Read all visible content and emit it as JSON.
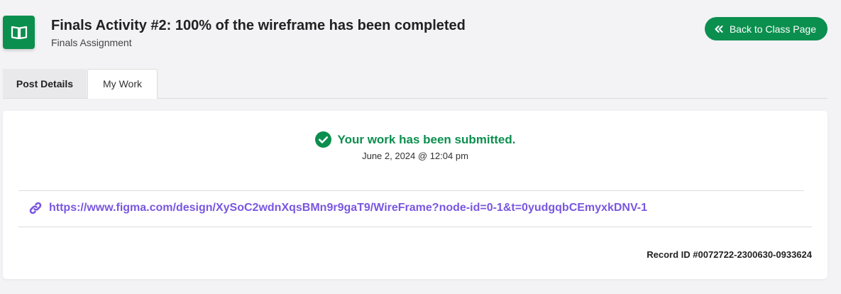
{
  "header": {
    "title": "Finals Activity #2: 100% of the wireframe has been completed",
    "subtitle": "Finals Assignment",
    "icon": "book-open-icon",
    "back_button_label": "Back to Class Page",
    "back_button_icon": "double-chevron-left-icon"
  },
  "tabs": [
    {
      "label": "Post Details",
      "active": false
    },
    {
      "label": "My Work",
      "active": true
    }
  ],
  "submission": {
    "status_text": "Your work has been submitted.",
    "status_icon": "check-circle-icon",
    "date": "June 2, 2024 @ 12:04 pm",
    "link_icon": "link-icon",
    "link": "https://www.figma.com/design/XySoC2wdnXqsBMn9r9gaT9/WireFrame?node-id=0-1&t=0yudgqbCEmyxkDNV-1",
    "record_id": "Record ID #0072722-2300630-0933624"
  },
  "colors": {
    "brand_green": "#0b8f4e",
    "link_purple": "#7a57e0",
    "page_background": "#f3f3f5"
  }
}
